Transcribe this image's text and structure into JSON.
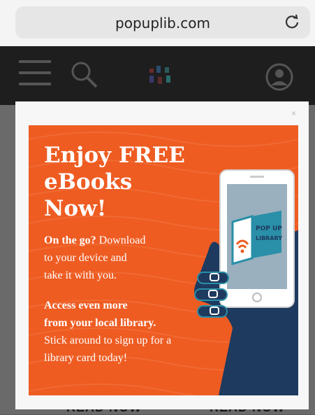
{
  "browser": {
    "url": "popuplib.com"
  },
  "site": {
    "header_icons": [
      "menu-icon",
      "search-icon",
      "logo-mark",
      "profile-icon"
    ]
  },
  "behind": {
    "left_label": "READ NOW",
    "right_label": "READ NOW"
  },
  "modal": {
    "close_label": "×",
    "promo": {
      "headline_line1": "Enjoy FREE",
      "headline_line2": "eBooks",
      "headline_line3": "Now!",
      "p1_bold": "On the go?",
      "p1_rest_1": " Download",
      "p1_line2": "to your device and",
      "p1_line3": "take it with you.",
      "p2_bold_1": "Access even more",
      "p2_bold_2": "from your local library.",
      "p2_rest_1": "Stick around to sign up for a",
      "p2_rest_2": "library card today!",
      "logo_text": "POP UP LIBRARY",
      "colors": {
        "orange": "#ee5c22",
        "navy": "#1e3a5f",
        "teal": "#2a8fa8"
      }
    }
  }
}
